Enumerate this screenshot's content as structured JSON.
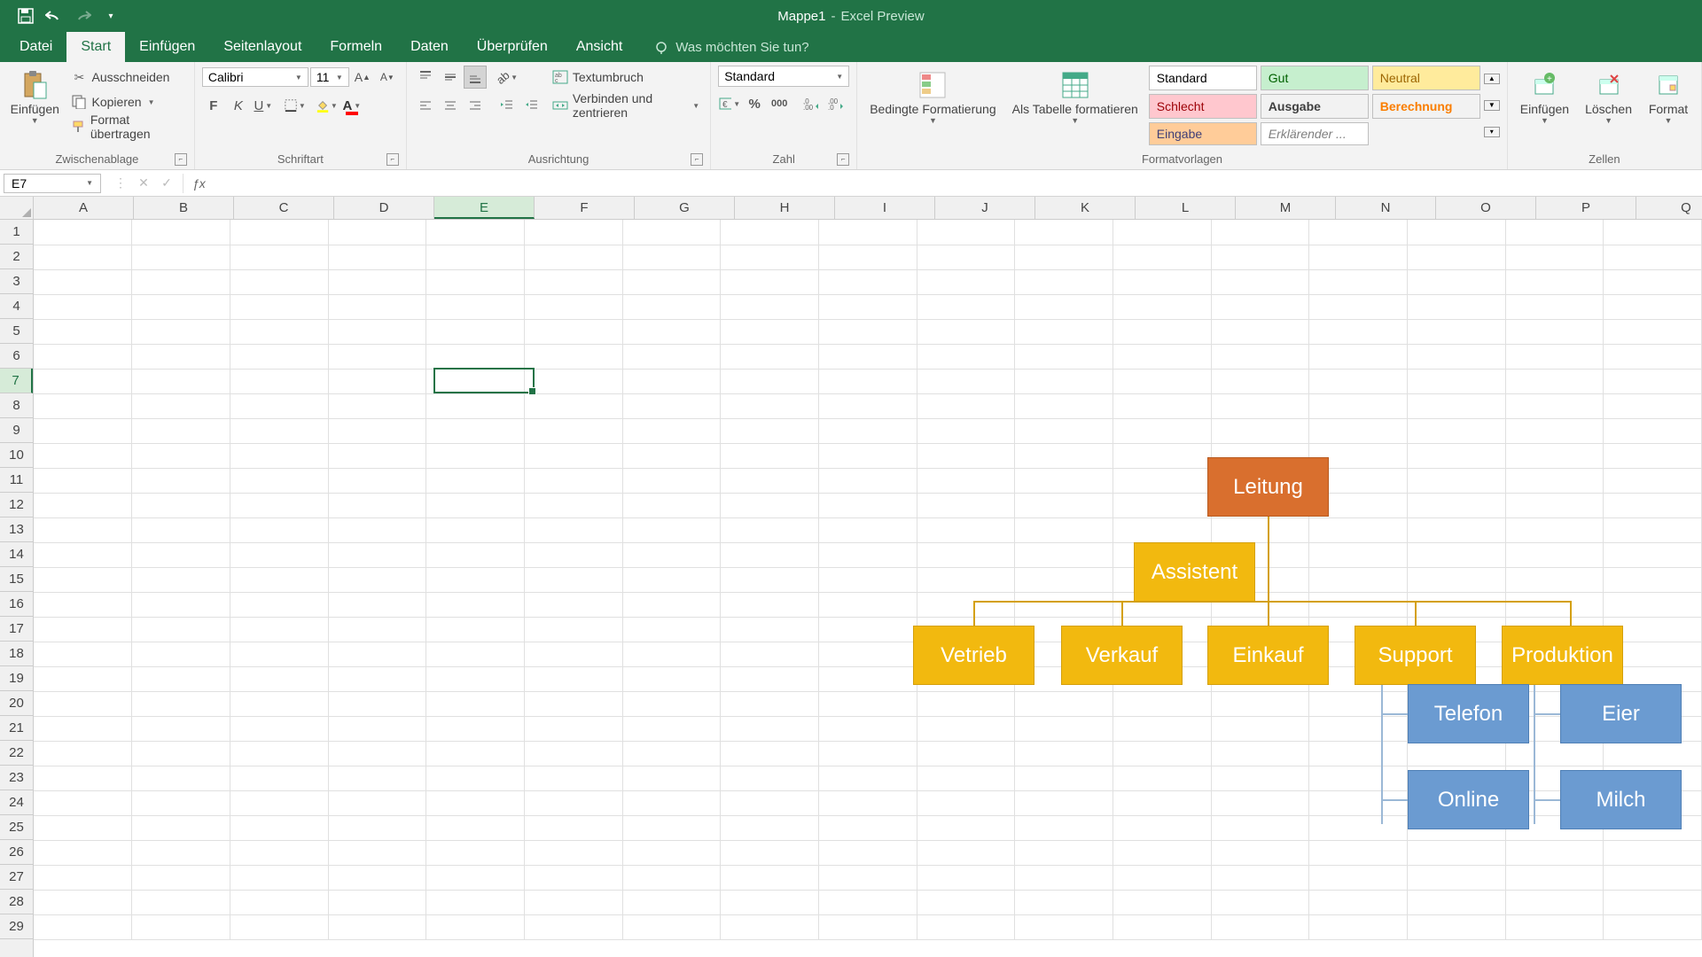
{
  "title": {
    "workbook": "Mappe1",
    "sep": "-",
    "app": "Excel Preview"
  },
  "tabs": {
    "datei": "Datei",
    "start": "Start",
    "einfuegen": "Einfügen",
    "seitenlayout": "Seitenlayout",
    "formeln": "Formeln",
    "daten": "Daten",
    "ueberpruefen": "Überprüfen",
    "ansicht": "Ansicht",
    "tellme": "Was möchten Sie tun?"
  },
  "ribbon": {
    "zwischenablage": {
      "label": "Zwischenablage",
      "einfuegen": "Einfügen",
      "ausschneiden": "Ausschneiden",
      "kopieren": "Kopieren",
      "format_uebertragen": "Format übertragen"
    },
    "schriftart": {
      "label": "Schriftart",
      "font": "Calibri",
      "size": "11"
    },
    "ausrichtung": {
      "label": "Ausrichtung",
      "textumbruch": "Textumbruch",
      "verbinden": "Verbinden und zentrieren"
    },
    "zahl": {
      "label": "Zahl",
      "format": "Standard"
    },
    "formatvorlagen": {
      "label": "Formatvorlagen",
      "bedingte": "Bedingte Formatierung",
      "als_tabelle": "Als Tabelle formatieren",
      "styles": {
        "standard": "Standard",
        "gut": "Gut",
        "neutral": "Neutral",
        "schlecht": "Schlecht",
        "ausgabe": "Ausgabe",
        "berechnung": "Berechnung",
        "eingabe": "Eingabe",
        "erklaerender": "Erklärender ..."
      }
    },
    "zellen": {
      "label": "Zellen",
      "einfuegen": "Einfügen",
      "loeschen": "Löschen",
      "format": "Format"
    }
  },
  "namebox": "E7",
  "columns": [
    "A",
    "B",
    "C",
    "D",
    "E",
    "F",
    "G",
    "H",
    "I",
    "J",
    "K",
    "L",
    "M",
    "N",
    "O",
    "P",
    "Q"
  ],
  "rows": [
    "1",
    "2",
    "3",
    "4",
    "5",
    "6",
    "7",
    "8",
    "9",
    "10",
    "11",
    "12",
    "13",
    "14",
    "15",
    "16",
    "17",
    "18",
    "19",
    "20",
    "21",
    "22",
    "23",
    "24",
    "25",
    "26",
    "27",
    "28",
    "29"
  ],
  "selected_cell": {
    "col": 4,
    "row": 6
  },
  "chart_data": {
    "type": "org-chart",
    "root": {
      "label": "Leitung",
      "color": "orange"
    },
    "assistant": {
      "label": "Assistent",
      "color": "yellow"
    },
    "departments": [
      {
        "label": "Vetrieb",
        "color": "yellow",
        "children": []
      },
      {
        "label": "Verkauf",
        "color": "yellow",
        "children": []
      },
      {
        "label": "Einkauf",
        "color": "yellow",
        "children": []
      },
      {
        "label": "Support",
        "color": "yellow",
        "children": [
          {
            "label": "Telefon",
            "color": "blue"
          },
          {
            "label": "Online",
            "color": "blue"
          }
        ]
      },
      {
        "label": "Produktion",
        "color": "yellow",
        "children": [
          {
            "label": "Eier",
            "color": "blue"
          },
          {
            "label": "Milch",
            "color": "blue"
          }
        ]
      }
    ]
  }
}
